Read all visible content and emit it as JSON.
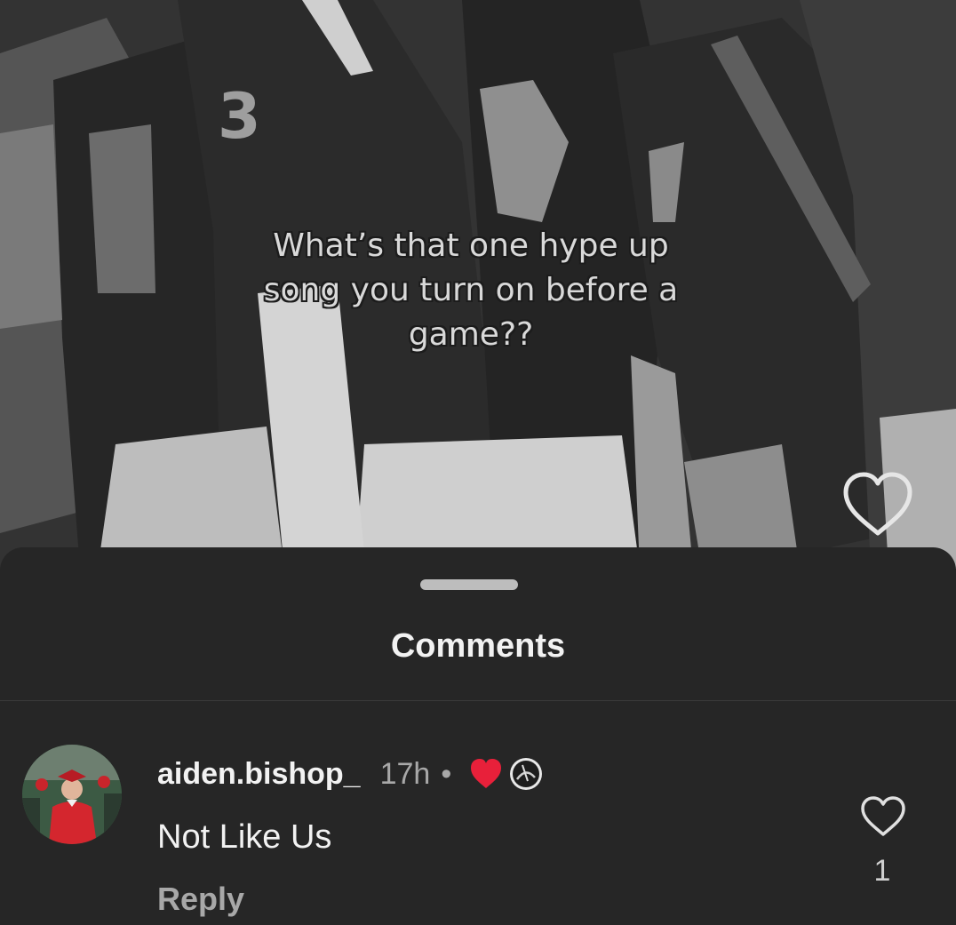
{
  "video": {
    "caption": "What’s that one hype up song you turn on before a game??",
    "like_icon": "heart-outline-icon"
  },
  "sheet": {
    "title": "Comments"
  },
  "comments": [
    {
      "username": "aiden.bishop_",
      "time": "17h",
      "separator": "•",
      "creator_liked_icon": "red-heart-icon",
      "text": "Not Like Us",
      "reply_label": "Reply",
      "like_count": "1",
      "like_icon": "heart-outline-icon"
    }
  ],
  "colors": {
    "sheet_bg": "#262626",
    "heart_red": "#e8203a",
    "text_primary": "#f2f2f2",
    "text_secondary": "#a8a8a8"
  }
}
